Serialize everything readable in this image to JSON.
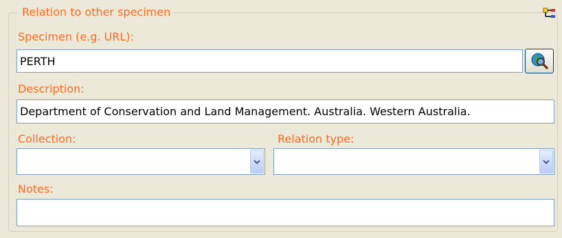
{
  "group": {
    "title": "Relation to other specimen"
  },
  "specimen": {
    "label": "Specimen (e.g. URL):",
    "value": "PERTH"
  },
  "description": {
    "label": "Description:",
    "value": "Department of Conservation and Land Management. Australia. Western Australia."
  },
  "collection": {
    "label": "Collection:",
    "value": ""
  },
  "relation_type": {
    "label": "Relation type:",
    "value": ""
  },
  "notes": {
    "label": "Notes:",
    "value": ""
  },
  "icons": {
    "lookup": "globe-search-icon",
    "corner": "relation-tree-icon",
    "dropdown": "chevron-down-icon"
  },
  "colors": {
    "label_text": "#ff6a23",
    "background": "#ece9d8",
    "field_border": "#7f9db9"
  }
}
